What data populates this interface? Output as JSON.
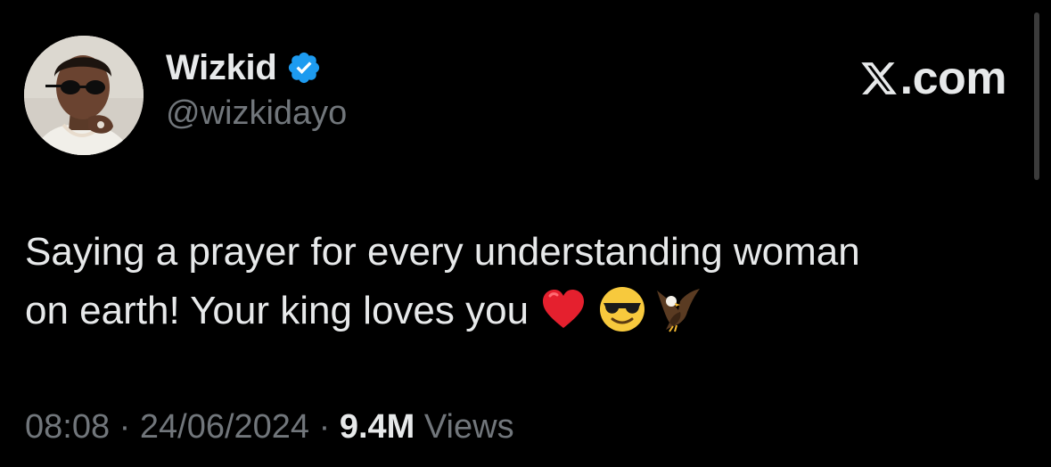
{
  "author": {
    "display_name": "Wizkid",
    "handle": "@wizkidayo",
    "verified": true,
    "verified_color": "#1d9bf0"
  },
  "brand": {
    "logo_icon": "x-logo-icon",
    "label": ".com"
  },
  "tweet": {
    "line1": "Saying a prayer for every understanding woman",
    "line2": "on earth! Your king loves you",
    "emojis": [
      "red-heart-emoji",
      "sunglasses-face-emoji",
      "eagle-emoji"
    ]
  },
  "meta": {
    "time": "08:08",
    "separator1": " · ",
    "date": "24/06/2024",
    "separator2": " · ",
    "views_count": "9.4M",
    "views_label": " Views"
  },
  "colors": {
    "background": "#000000",
    "primary_text": "#e7e9ea",
    "secondary_text": "#71767b"
  }
}
